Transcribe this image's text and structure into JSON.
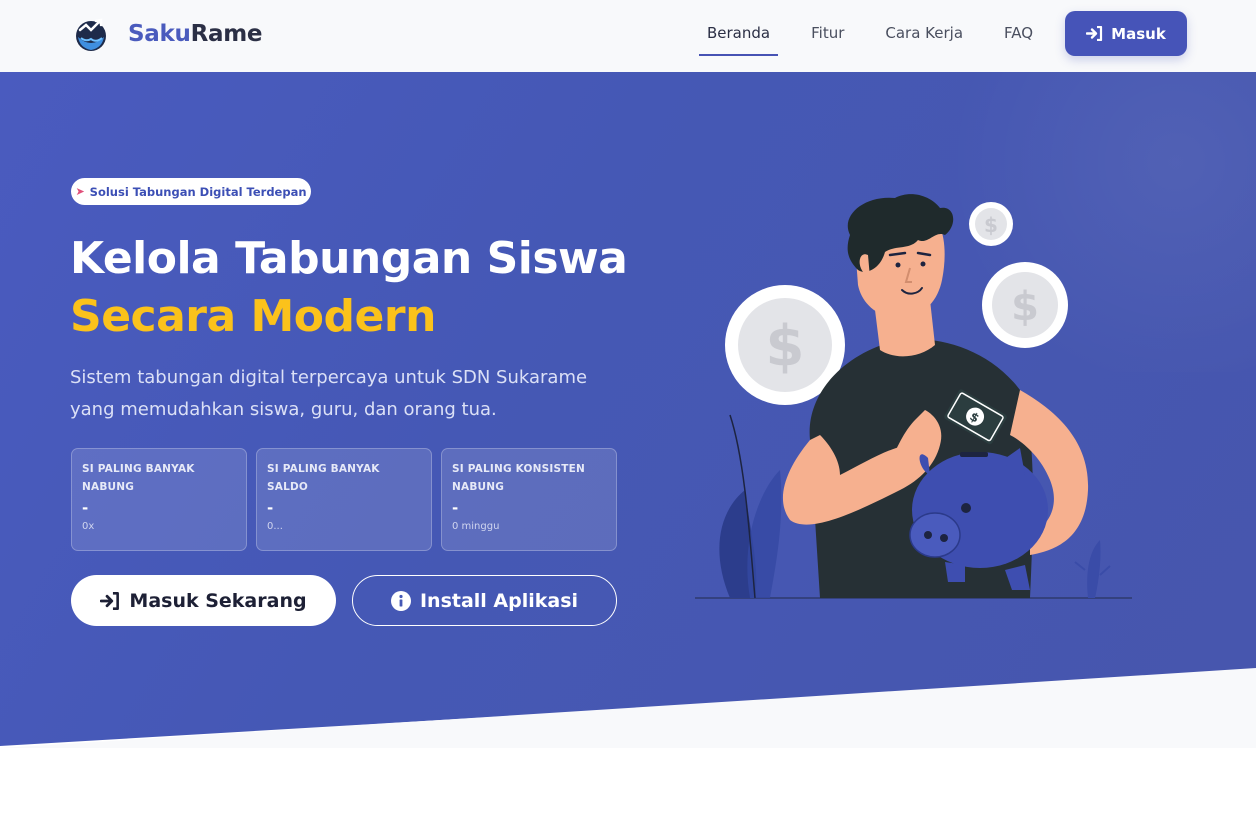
{
  "navbar": {
    "brand": {
      "prefix": "Saku",
      "suffix": "Rame"
    },
    "links": [
      {
        "label": "Beranda",
        "active": true
      },
      {
        "label": "Fitur",
        "active": false
      },
      {
        "label": "Cara Kerja",
        "active": false
      },
      {
        "label": "FAQ",
        "active": false
      }
    ],
    "cta_label": "Masuk"
  },
  "hero": {
    "badge": "Solusi Tabungan Digital Terdepan",
    "title_line1": "Kelola Tabungan Siswa",
    "title_line2": "Secara Modern",
    "subtitle": "Sistem tabungan digital terpercaya untuk SDN Sukarame yang memudahkan siswa, guru, dan orang tua.",
    "stats": [
      {
        "label": "SI PALING BANYAK NABUNG",
        "value": "-",
        "meta": "0x"
      },
      {
        "label": "SI PALING BANYAK SALDO",
        "value": "-",
        "meta": "0..."
      },
      {
        "label": "SI PALING KONSISTEN NABUNG",
        "value": "-",
        "meta": "0 minggu"
      }
    ],
    "primary_button": "Masuk Sekarang",
    "secondary_button": "Install Aplikasi"
  },
  "colors": {
    "brand": "#4654b8",
    "hero_bg": "#4558b5",
    "accent_yellow": "#fbc21b",
    "piggy": "#3e4eb0"
  },
  "icons": {
    "logo": "piggy-coin-logo",
    "login": "sign-in-icon",
    "info": "info-circle-icon",
    "rocket": "rocket-icon"
  }
}
